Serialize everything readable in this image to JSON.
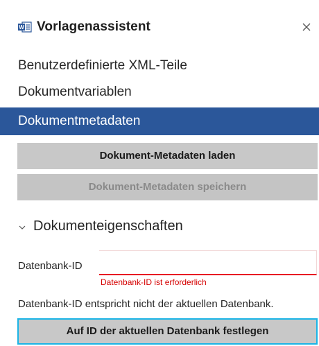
{
  "header": {
    "title": "Vorlagenassistent",
    "app_icon": "word-document-icon",
    "close_icon": "close-icon"
  },
  "nav": {
    "items": [
      {
        "label": "Benutzerdefinierte XML-Teile",
        "active": false
      },
      {
        "label": "Dokumentvariablen",
        "active": false
      },
      {
        "label": "Dokumentmetadaten",
        "active": true
      }
    ]
  },
  "actions": {
    "load_label": "Dokument-Metadaten laden",
    "save_label": "Dokument-Metadaten speichern"
  },
  "section": {
    "title": "Dokumenteigenschaften",
    "expanded": true,
    "chevron_icon": "chevron-down-icon"
  },
  "form": {
    "database_id_label": "Datenbank-ID",
    "database_id_value": "",
    "database_id_error": "Datenbank-ID ist erforderlich",
    "mismatch_message": "Datenbank-ID entspricht nicht der aktuellen Datenbank.",
    "set_current_db_label": "Auf ID der aktuellen Datenbank festlegen"
  },
  "colors": {
    "accent": "#2b579a",
    "button_bg": "#c8c8c8",
    "error": "#d50000",
    "focus_ring": "#1ab4e6"
  }
}
